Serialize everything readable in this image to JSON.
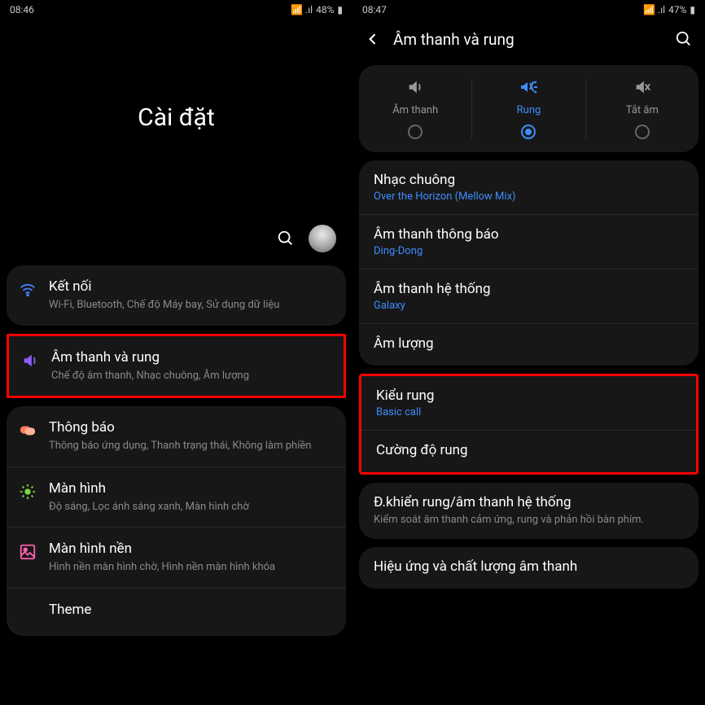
{
  "left": {
    "status": {
      "time": "08:46",
      "battery": "48%"
    },
    "title": "Cài đặt",
    "items": [
      {
        "icon": "wifi",
        "color": "#4a7fff",
        "title": "Kết nối",
        "sub": "Wi-Fi, Bluetooth, Chế độ Máy bay, Sử dụng dữ liệu"
      },
      {
        "icon": "sound",
        "color": "#8a5fff",
        "title": "Âm thanh và rung",
        "sub": "Chế độ âm thanh, Nhạc chuông, Âm lượng",
        "highlight": true
      },
      {
        "icon": "notif",
        "color": "#ff7b5c",
        "title": "Thông báo",
        "sub": "Thông báo ứng dụng, Thanh trạng thái, Không làm phiền"
      },
      {
        "icon": "display",
        "color": "#7fd645",
        "title": "Màn hình",
        "sub": "Độ sáng, Lọc ánh sáng xanh, Màn hình chờ"
      },
      {
        "icon": "wallpaper",
        "color": "#ff5fa8",
        "title": "Màn hình nền",
        "sub": "Hình nền màn hình chờ, Hình nền màn hình khóa"
      },
      {
        "icon": "theme",
        "color": "#888",
        "title": "Theme",
        "sub": ""
      }
    ]
  },
  "right": {
    "status": {
      "time": "08:47",
      "battery": "47%"
    },
    "header": "Âm thanh và rung",
    "modes": [
      {
        "label": "Âm thanh",
        "icon": "sound-on"
      },
      {
        "label": "Rung",
        "icon": "vibrate",
        "active": true
      },
      {
        "label": "Tắt âm",
        "icon": "mute"
      }
    ],
    "section1": [
      {
        "title": "Nhạc chuông",
        "sub": "Over the Horizon (Mellow Mix)"
      },
      {
        "title": "Âm thanh thông báo",
        "sub": "Ding-Dong"
      },
      {
        "title": "Âm thanh hệ thống",
        "sub": "Galaxy"
      },
      {
        "title": "Âm lượng"
      }
    ],
    "section2": [
      {
        "title": "Kiểu rung",
        "sub": "Basic call"
      },
      {
        "title": "Cường độ rung"
      }
    ],
    "section3": [
      {
        "title": "Đ.khiển rung/âm thanh hệ thống",
        "desc": "Kiểm soát âm thanh cảm ứng, rung và phản hồi bàn phím."
      }
    ],
    "section4": [
      {
        "title": "Hiệu ứng và chất lượng âm thanh"
      }
    ]
  }
}
